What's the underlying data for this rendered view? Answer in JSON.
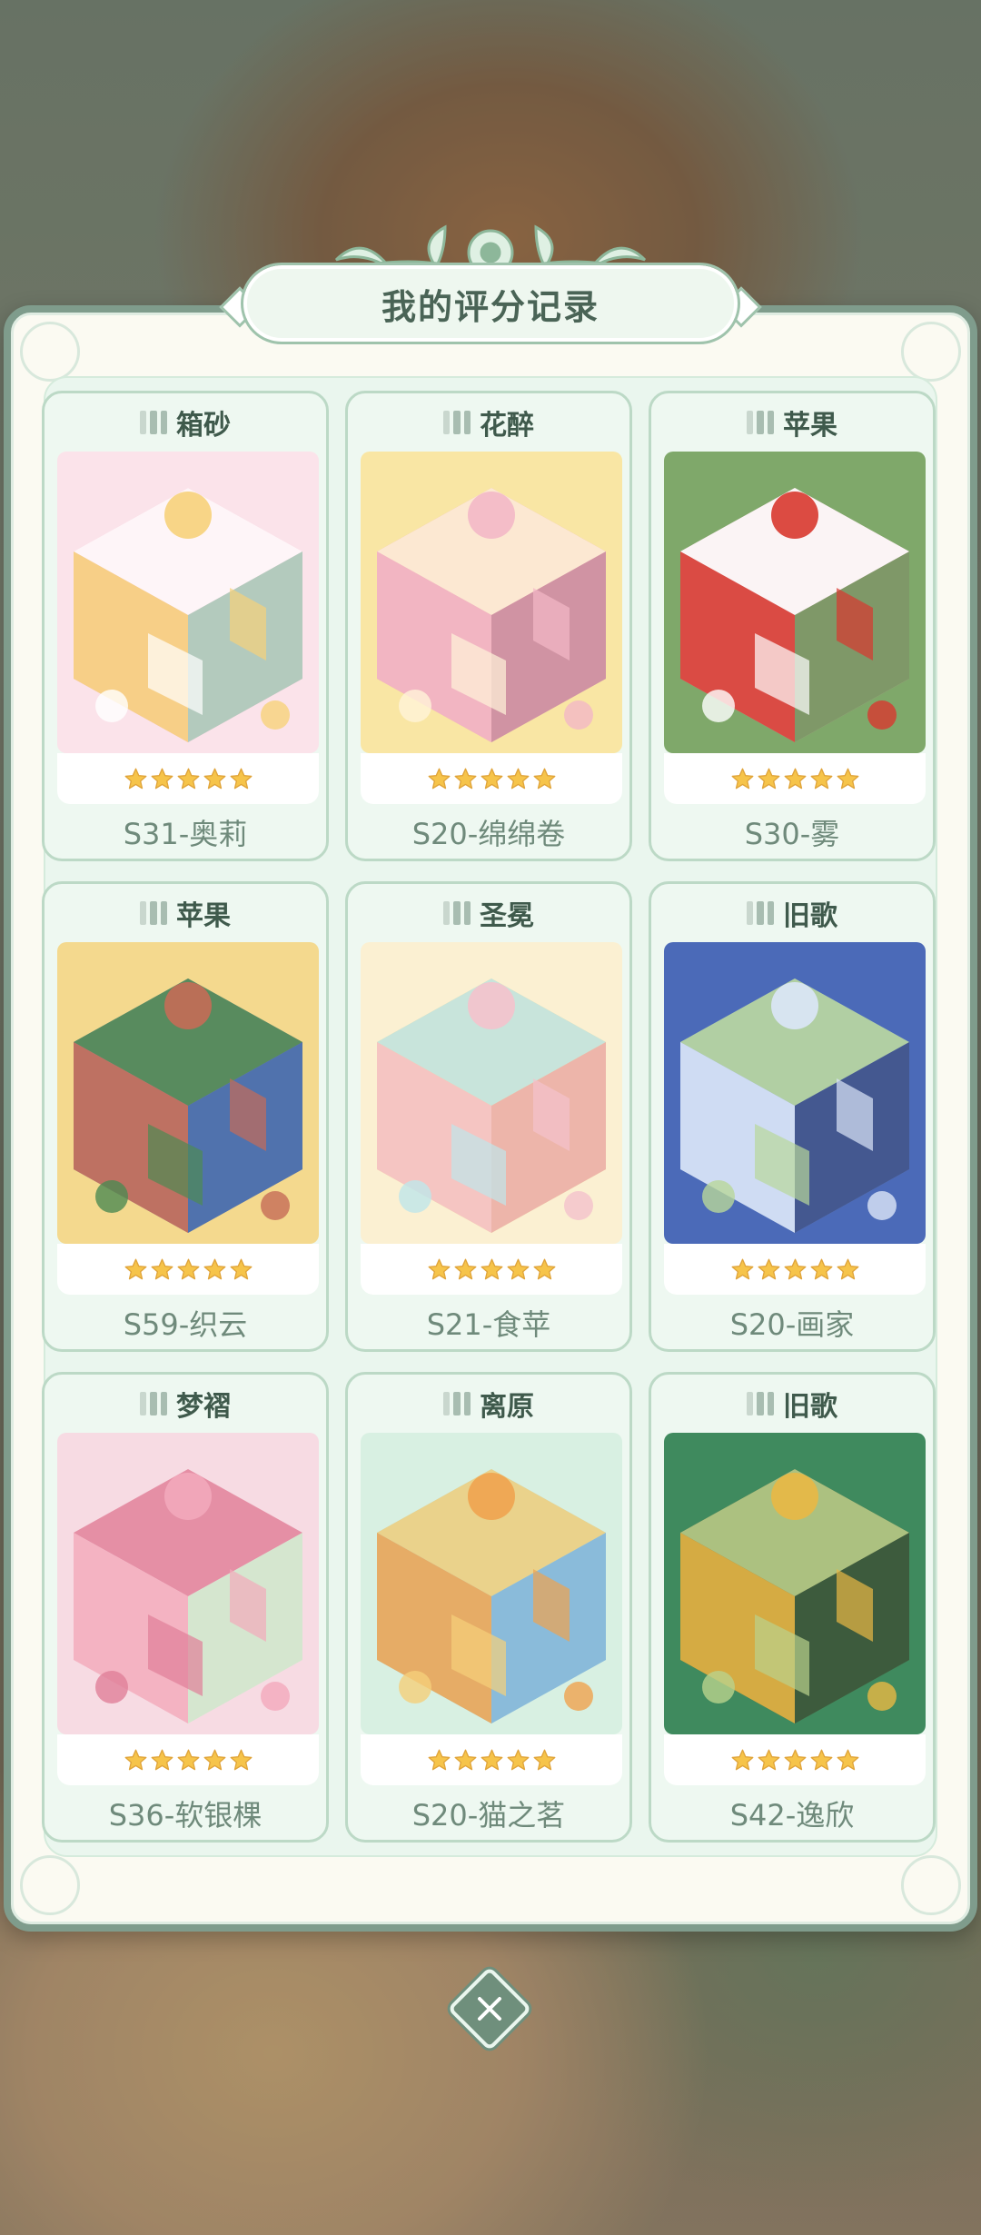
{
  "dialog": {
    "title": "我的评分记录"
  },
  "records": [
    {
      "author": "箱砂",
      "name": "S31-奥莉",
      "rating": 5,
      "theme": "pink-yellow-room"
    },
    {
      "author": "花醉",
      "name": "S20-绵绵卷",
      "rating": 5,
      "theme": "pink-tower-yellow"
    },
    {
      "author": "苹果",
      "name": "S30-雾",
      "rating": 5,
      "theme": "red-apple-house"
    },
    {
      "author": "苹果",
      "name": "S59-织云",
      "rating": 5,
      "theme": "autumn-house"
    },
    {
      "author": "圣冕",
      "name": "S21-食苹",
      "rating": 5,
      "theme": "pastel-moon-room"
    },
    {
      "author": "旧歌",
      "name": "S20-画家",
      "rating": 5,
      "theme": "blue-night-garden"
    },
    {
      "author": "梦褶",
      "name": "S36-软银棵",
      "rating": 5,
      "theme": "pink-two-floor-room"
    },
    {
      "author": "离原",
      "name": "S20-猫之茗",
      "rating": 5,
      "theme": "mushroom-water-garden"
    },
    {
      "author": "旧歌",
      "name": "S42-逸欣",
      "rating": 5,
      "theme": "green-gramophone-house"
    }
  ],
  "icons": {
    "author_badge": "bars-icon",
    "rating": "star-icon",
    "close": "close-icon"
  },
  "colors": {
    "panel_border": "#7f9c8c",
    "card_bg": "#eef8f1",
    "star_fill": "#f6c44a",
    "title_text": "#4a6456"
  }
}
